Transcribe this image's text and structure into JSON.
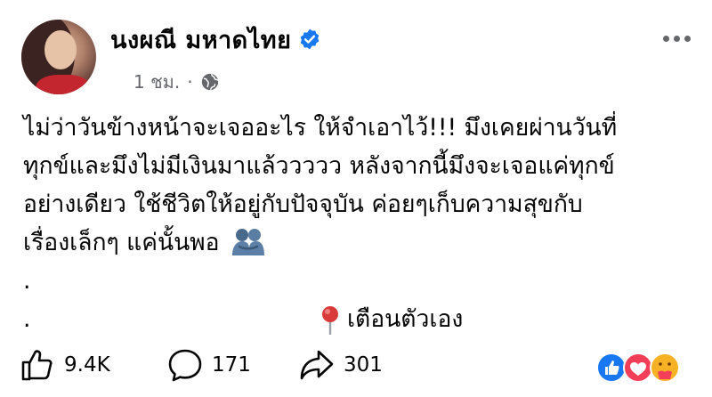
{
  "post": {
    "author_name": "นงผณี มหาดไทย",
    "time": "1 ชม.",
    "time_separator": "·",
    "icons": {
      "verified": "verified-badge-icon",
      "audience": "globe-icon",
      "more": "more-options-icon"
    },
    "text_lines": [
      "ไม่ว่าวันข้างหน้าจะเจออะไร ให้จำเอาไว้!!! มึงเคยผ่านวันที่",
      "ทุกข์และมึงไม่มีเงินมาแล้ววววว หลังจากนี้มึงจะเจอแค่ทุกข์",
      "อย่างเดียว ใช้ชีวิตให้อยู่กับปัจจุบัน ค่อยๆเก็บความสุขกับ",
      "เรื่องเล็กๆ แค่นั้นพอ"
    ],
    "dot_1": ".",
    "dot_2": ".",
    "note": "เตือนตัวเอง",
    "note_icon": "round-pushpin-icon",
    "hug_emoji_icon": "people-hugging-icon"
  },
  "stats": {
    "likes": "9.4K",
    "comments": "171",
    "shares": "301"
  },
  "colors": {
    "verified": "#1877f2",
    "secondary_text": "#65676b",
    "like_reaction": "#1877f2",
    "love_reaction": "#f33e58",
    "care_reaction": "#f7b125"
  }
}
